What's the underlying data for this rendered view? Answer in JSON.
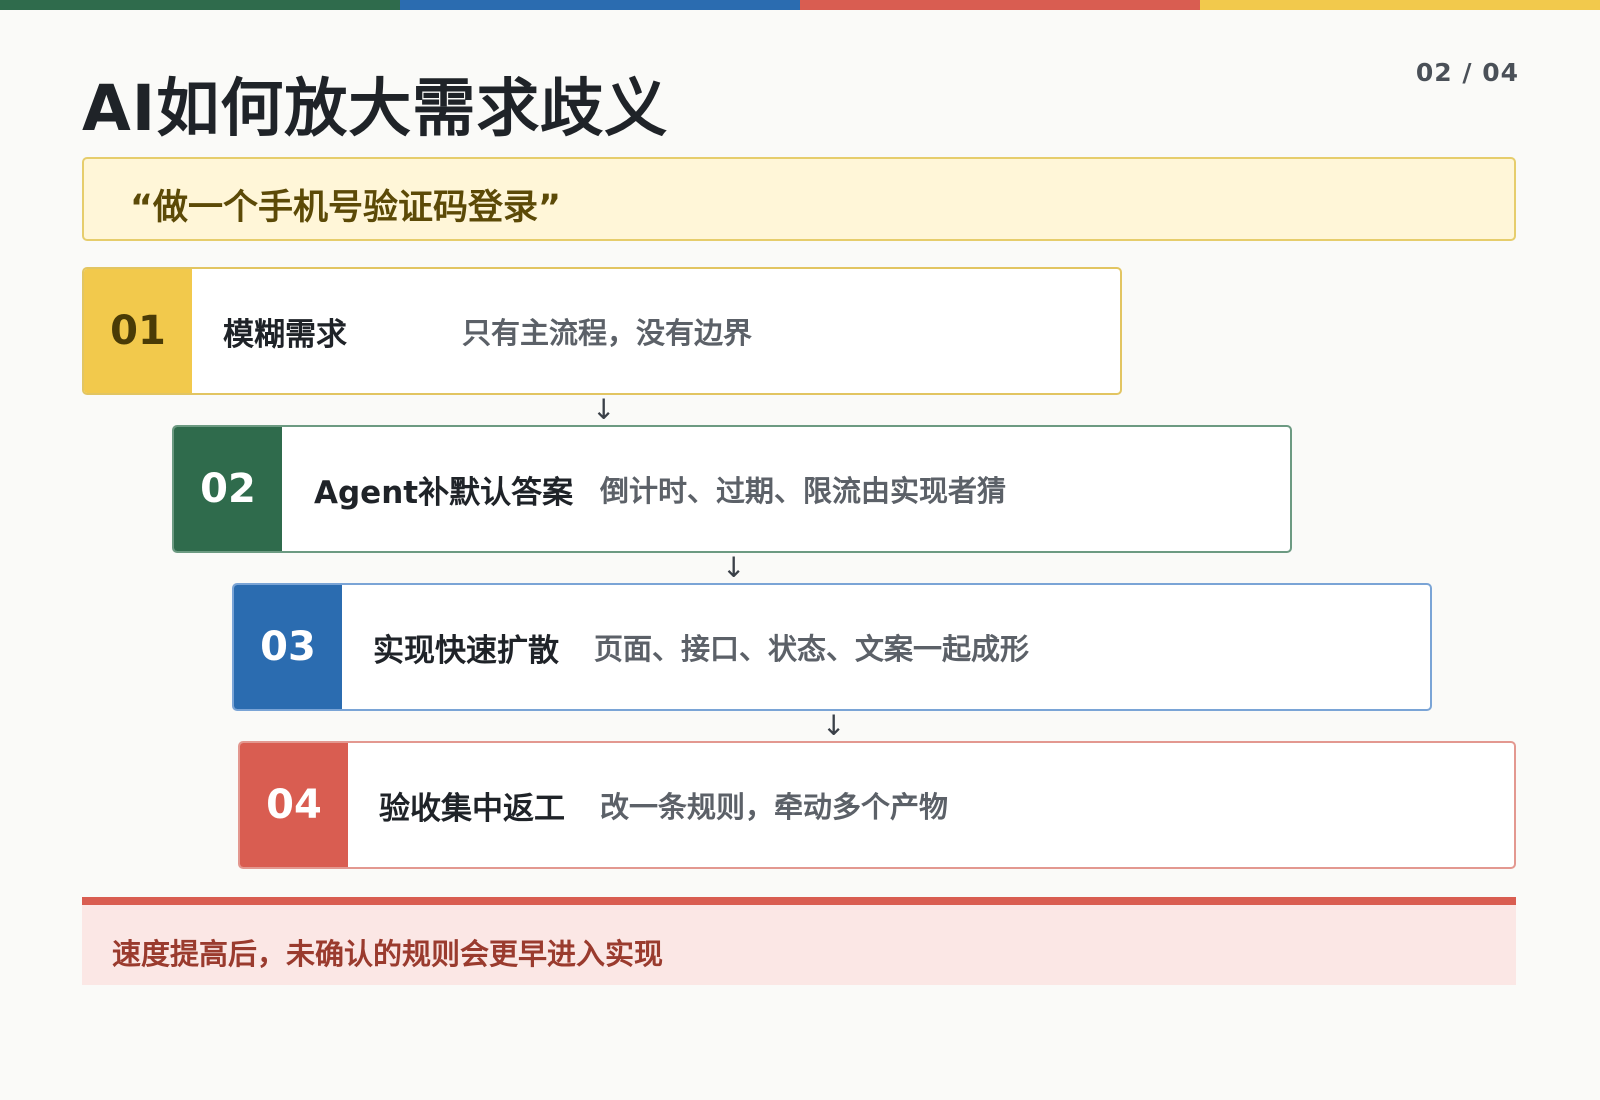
{
  "header": {
    "title": "AI如何放大需求歧义",
    "page_counter": "02 / 04",
    "accent_colors": [
      "#2f6b4c",
      "#2b6cb0",
      "#d95d51",
      "#f2c94c"
    ]
  },
  "quote": {
    "text": "“做一个手机号验证码登录”"
  },
  "steps": [
    {
      "number": "01",
      "title": "模糊需求",
      "description": "只有主流程，没有边界",
      "color": "#f2c94c",
      "number_color": "#4a3b06",
      "border_color": "#e2c562"
    },
    {
      "number": "02",
      "title": "Agent补默认答案",
      "description": "倒计时、过期、限流由实现者猜",
      "color": "#2f6b4c",
      "number_color": "#ffffff",
      "border_color": "#6c9a82"
    },
    {
      "number": "03",
      "title": "实现快速扩散",
      "description": "页面、接口、状态、文案一起成形",
      "color": "#2b6cb0",
      "number_color": "#ffffff",
      "border_color": "#7aa4d6"
    },
    {
      "number": "04",
      "title": "验收集中返工",
      "description": "改一条规则，牵动多个产物",
      "color": "#d95d51",
      "number_color": "#ffffff",
      "border_color": "#e39890"
    }
  ],
  "arrow_symbol": "↓",
  "note": {
    "text": "速度提高后，未确认的规则会更早进入实现"
  }
}
